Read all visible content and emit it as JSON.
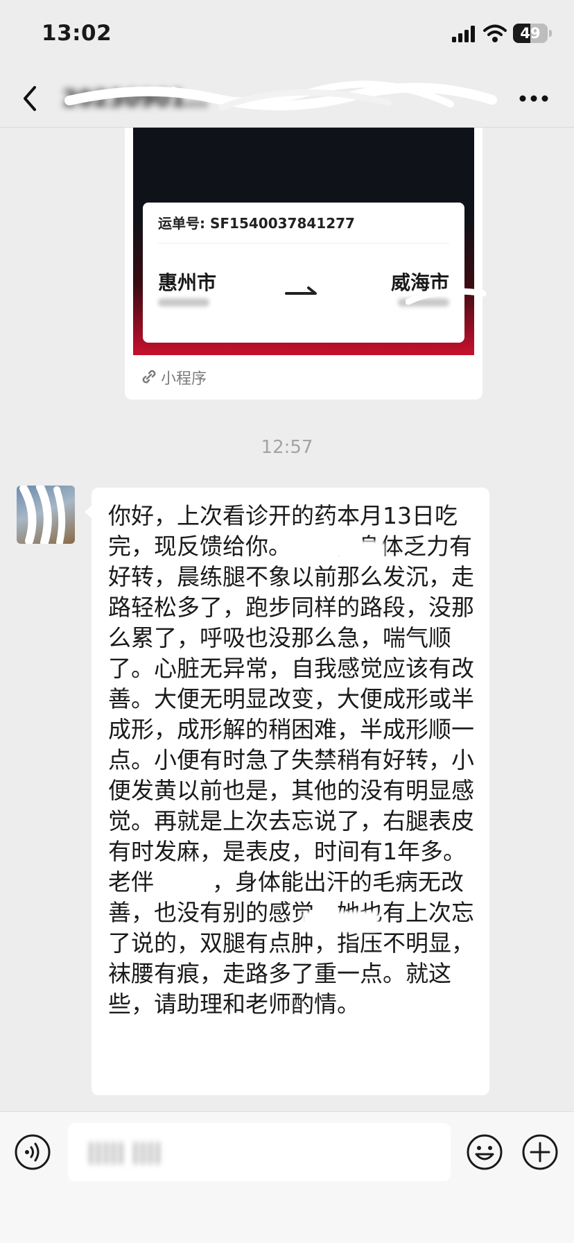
{
  "status_bar": {
    "time": "13:02",
    "battery_level": "49",
    "battery_fraction": 0.49
  },
  "nav": {
    "title": "20230901…",
    "back_icon": "chevron-left-icon",
    "more_icon": "ellipsis-icon"
  },
  "mini_program_card": {
    "waybill_label": "运单号:",
    "waybill_number": "SF1540037841277",
    "origin_city": "惠州市",
    "destination_city": "威海市",
    "source_label": "小程序",
    "source_icon": "link-icon",
    "header_bg_color": "#0f1218",
    "footer_accent_color": "#c8102e"
  },
  "timestamp": "12:57",
  "message": {
    "text": "你好，上次看诊开的药本月13日吃完，现反馈给你。      ，身体乏力有好转，晨练腿不象以前那么发沉，走路轻松多了，跑步同样的路段，没那么累了，呼吸也没那么急，喘气顺了。心脏无异常，自我感觉应该有改善。大便无明显改变，大便成形或半成形，成形解的稍困难，半成形顺一点。小便有时急了失禁稍有好转，小便发黄以前也是，其他的没有明显感觉。再就是上次去忘说了，右腿表皮有时发麻，是表皮，时间有1年多。老伴        ，身体能出汗的毛病无改善，也没有别的感觉。她也有上次忘了说的，双腿有点肿，指压不明显，袜腰有痕，走路多了重一点。就这些，请助理和老师酌情。"
  },
  "input_bar": {
    "draft": "||||| ||||",
    "voice_icon": "voice-icon",
    "emoji_icon": "smiley-icon",
    "plus_icon": "plus-icon"
  }
}
